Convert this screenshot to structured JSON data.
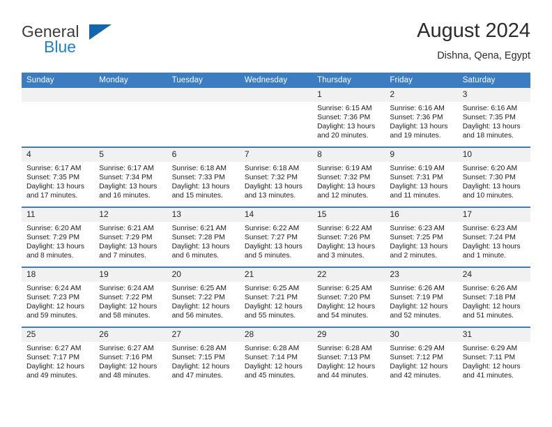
{
  "brand": {
    "line1": "General",
    "line2": "Blue",
    "logo_icon": "triangle-logo-icon",
    "accent_color": "#1f7fd0"
  },
  "header": {
    "title": "August 2024",
    "subtitle": "Dishna, Qena, Egypt"
  },
  "theme": {
    "header_blue": "#3b7dc0",
    "daynum_gray": "#f1f1f1",
    "text": "#1c1c1c"
  },
  "weekday_headers": [
    "Sunday",
    "Monday",
    "Tuesday",
    "Wednesday",
    "Thursday",
    "Friday",
    "Saturday"
  ],
  "labels": {
    "sunrise": "Sunrise:",
    "sunset": "Sunset:",
    "daylight": "Daylight:"
  },
  "weeks": [
    [
      {
        "day": "",
        "sunrise": "",
        "sunset": "",
        "daylight": "",
        "empty": true
      },
      {
        "day": "",
        "sunrise": "",
        "sunset": "",
        "daylight": "",
        "empty": true
      },
      {
        "day": "",
        "sunrise": "",
        "sunset": "",
        "daylight": "",
        "empty": true
      },
      {
        "day": "",
        "sunrise": "",
        "sunset": "",
        "daylight": "",
        "empty": true
      },
      {
        "day": "1",
        "sunrise": "Sunrise: 6:15 AM",
        "sunset": "Sunset: 7:36 PM",
        "daylight": "Daylight: 13 hours and 20 minutes."
      },
      {
        "day": "2",
        "sunrise": "Sunrise: 6:16 AM",
        "sunset": "Sunset: 7:36 PM",
        "daylight": "Daylight: 13 hours and 19 minutes."
      },
      {
        "day": "3",
        "sunrise": "Sunrise: 6:16 AM",
        "sunset": "Sunset: 7:35 PM",
        "daylight": "Daylight: 13 hours and 18 minutes."
      }
    ],
    [
      {
        "day": "4",
        "sunrise": "Sunrise: 6:17 AM",
        "sunset": "Sunset: 7:35 PM",
        "daylight": "Daylight: 13 hours and 17 minutes."
      },
      {
        "day": "5",
        "sunrise": "Sunrise: 6:17 AM",
        "sunset": "Sunset: 7:34 PM",
        "daylight": "Daylight: 13 hours and 16 minutes."
      },
      {
        "day": "6",
        "sunrise": "Sunrise: 6:18 AM",
        "sunset": "Sunset: 7:33 PM",
        "daylight": "Daylight: 13 hours and 15 minutes."
      },
      {
        "day": "7",
        "sunrise": "Sunrise: 6:18 AM",
        "sunset": "Sunset: 7:32 PM",
        "daylight": "Daylight: 13 hours and 13 minutes."
      },
      {
        "day": "8",
        "sunrise": "Sunrise: 6:19 AM",
        "sunset": "Sunset: 7:32 PM",
        "daylight": "Daylight: 13 hours and 12 minutes."
      },
      {
        "day": "9",
        "sunrise": "Sunrise: 6:19 AM",
        "sunset": "Sunset: 7:31 PM",
        "daylight": "Daylight: 13 hours and 11 minutes."
      },
      {
        "day": "10",
        "sunrise": "Sunrise: 6:20 AM",
        "sunset": "Sunset: 7:30 PM",
        "daylight": "Daylight: 13 hours and 10 minutes."
      }
    ],
    [
      {
        "day": "11",
        "sunrise": "Sunrise: 6:20 AM",
        "sunset": "Sunset: 7:29 PM",
        "daylight": "Daylight: 13 hours and 8 minutes."
      },
      {
        "day": "12",
        "sunrise": "Sunrise: 6:21 AM",
        "sunset": "Sunset: 7:29 PM",
        "daylight": "Daylight: 13 hours and 7 minutes."
      },
      {
        "day": "13",
        "sunrise": "Sunrise: 6:21 AM",
        "sunset": "Sunset: 7:28 PM",
        "daylight": "Daylight: 13 hours and 6 minutes."
      },
      {
        "day": "14",
        "sunrise": "Sunrise: 6:22 AM",
        "sunset": "Sunset: 7:27 PM",
        "daylight": "Daylight: 13 hours and 5 minutes."
      },
      {
        "day": "15",
        "sunrise": "Sunrise: 6:22 AM",
        "sunset": "Sunset: 7:26 PM",
        "daylight": "Daylight: 13 hours and 3 minutes."
      },
      {
        "day": "16",
        "sunrise": "Sunrise: 6:23 AM",
        "sunset": "Sunset: 7:25 PM",
        "daylight": "Daylight: 13 hours and 2 minutes."
      },
      {
        "day": "17",
        "sunrise": "Sunrise: 6:23 AM",
        "sunset": "Sunset: 7:24 PM",
        "daylight": "Daylight: 13 hours and 1 minute."
      }
    ],
    [
      {
        "day": "18",
        "sunrise": "Sunrise: 6:24 AM",
        "sunset": "Sunset: 7:23 PM",
        "daylight": "Daylight: 12 hours and 59 minutes."
      },
      {
        "day": "19",
        "sunrise": "Sunrise: 6:24 AM",
        "sunset": "Sunset: 7:22 PM",
        "daylight": "Daylight: 12 hours and 58 minutes."
      },
      {
        "day": "20",
        "sunrise": "Sunrise: 6:25 AM",
        "sunset": "Sunset: 7:22 PM",
        "daylight": "Daylight: 12 hours and 56 minutes."
      },
      {
        "day": "21",
        "sunrise": "Sunrise: 6:25 AM",
        "sunset": "Sunset: 7:21 PM",
        "daylight": "Daylight: 12 hours and 55 minutes."
      },
      {
        "day": "22",
        "sunrise": "Sunrise: 6:25 AM",
        "sunset": "Sunset: 7:20 PM",
        "daylight": "Daylight: 12 hours and 54 minutes."
      },
      {
        "day": "23",
        "sunrise": "Sunrise: 6:26 AM",
        "sunset": "Sunset: 7:19 PM",
        "daylight": "Daylight: 12 hours and 52 minutes."
      },
      {
        "day": "24",
        "sunrise": "Sunrise: 6:26 AM",
        "sunset": "Sunset: 7:18 PM",
        "daylight": "Daylight: 12 hours and 51 minutes."
      }
    ],
    [
      {
        "day": "25",
        "sunrise": "Sunrise: 6:27 AM",
        "sunset": "Sunset: 7:17 PM",
        "daylight": "Daylight: 12 hours and 49 minutes."
      },
      {
        "day": "26",
        "sunrise": "Sunrise: 6:27 AM",
        "sunset": "Sunset: 7:16 PM",
        "daylight": "Daylight: 12 hours and 48 minutes."
      },
      {
        "day": "27",
        "sunrise": "Sunrise: 6:28 AM",
        "sunset": "Sunset: 7:15 PM",
        "daylight": "Daylight: 12 hours and 47 minutes."
      },
      {
        "day": "28",
        "sunrise": "Sunrise: 6:28 AM",
        "sunset": "Sunset: 7:14 PM",
        "daylight": "Daylight: 12 hours and 45 minutes."
      },
      {
        "day": "29",
        "sunrise": "Sunrise: 6:28 AM",
        "sunset": "Sunset: 7:13 PM",
        "daylight": "Daylight: 12 hours and 44 minutes."
      },
      {
        "day": "30",
        "sunrise": "Sunrise: 6:29 AM",
        "sunset": "Sunset: 7:12 PM",
        "daylight": "Daylight: 12 hours and 42 minutes."
      },
      {
        "day": "31",
        "sunrise": "Sunrise: 6:29 AM",
        "sunset": "Sunset: 7:11 PM",
        "daylight": "Daylight: 12 hours and 41 minutes."
      }
    ]
  ]
}
